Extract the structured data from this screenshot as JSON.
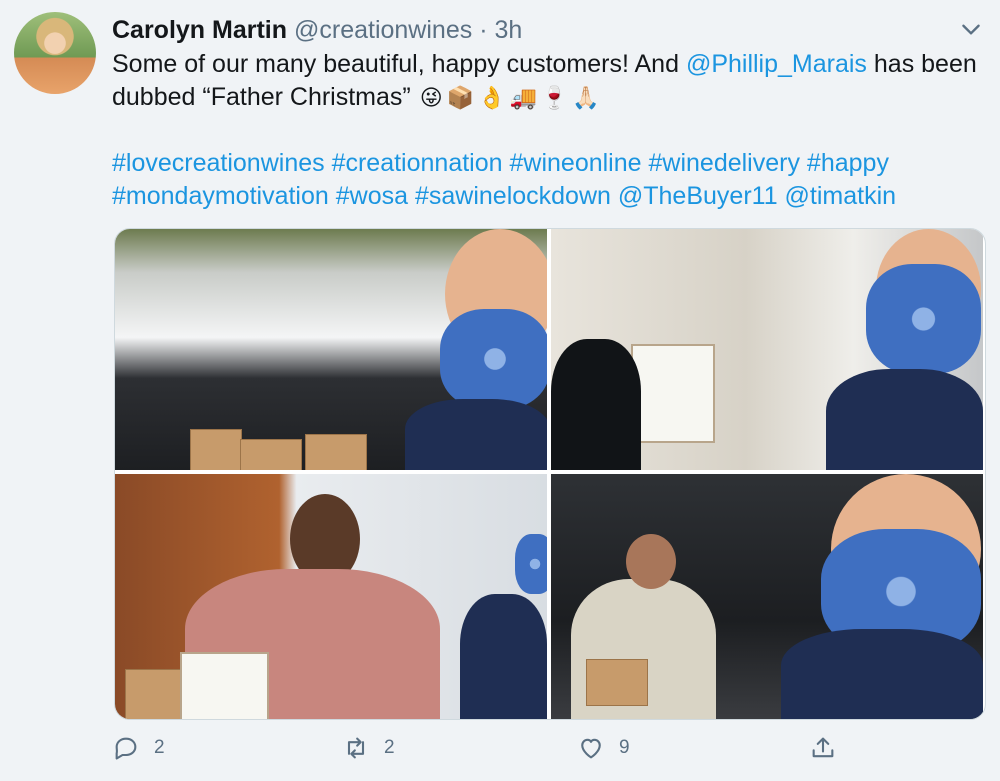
{
  "tweet": {
    "author_name": "Carolyn Martin",
    "author_handle": "@creationwines",
    "separator": "·",
    "time": "3h",
    "text_part1": "Some of our many beautiful, happy customers! And ",
    "mention": "@Phillip_Marais",
    "text_part2": " has been dubbed “Father Christmas”",
    "emojis": [
      "😜",
      "📦",
      "👌",
      "🚚",
      "🍷",
      "🙏🏻"
    ],
    "tags_line1": [
      "#lovecreationwines",
      "#creationnation",
      "#wineonline",
      "#winedelivery",
      "#happy"
    ],
    "tags_line2": [
      "#mondaymotivation",
      "#wosa",
      "#sawinelockdown",
      "@TheBuyer11",
      "@timatkin"
    ]
  },
  "actions": {
    "reply_count": "2",
    "retweet_count": "2",
    "like_count": "9"
  },
  "icons": {
    "more": "chevron-down-icon",
    "reply": "reply-icon",
    "retweet": "retweet-icon",
    "like": "heart-icon",
    "share": "share-icon"
  },
  "colors": {
    "link": "#1b95e0",
    "secondary_text": "#5b7083",
    "background": "#f0f3f6"
  }
}
